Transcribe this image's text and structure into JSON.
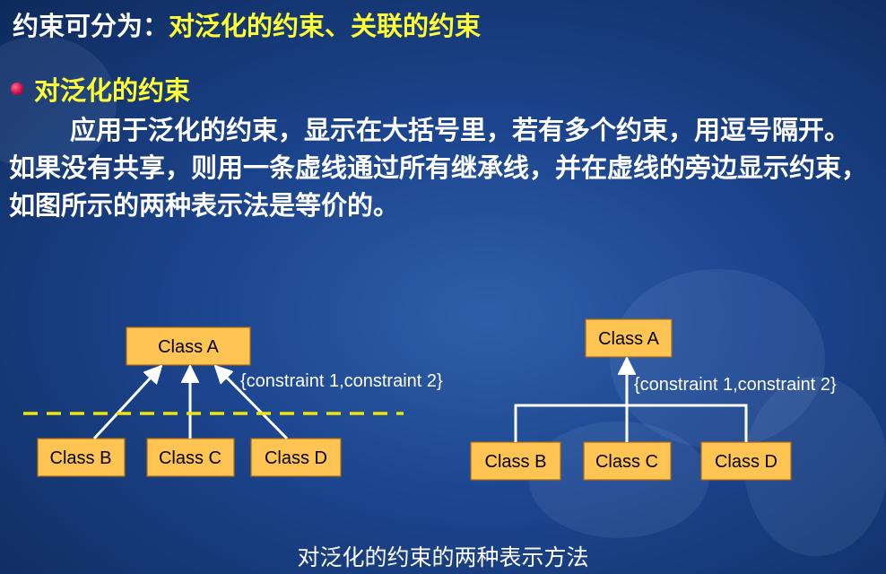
{
  "title": {
    "lead": "约束可分为：",
    "highlight": "对泛化的约束、关联的约束"
  },
  "section": {
    "bullet": "对泛化的约束"
  },
  "paragraph": "应用于泛化的约束，显示在大括号里，若有多个约束，用逗号隔开。如果没有共享，则用一条虚线通过所有继承线，并在虚线的旁边显示约束， 如图所示的两种表示法是等价的。",
  "diagram_left": {
    "parent": "Class A",
    "children": [
      "Class B",
      "Class C",
      "Class D"
    ],
    "constraint": "{constraint 1,constraint 2}"
  },
  "diagram_right": {
    "parent": "Class A",
    "children": [
      "Class B",
      "Class C",
      "Class D"
    ],
    "constraint": "{constraint 1,constraint 2}"
  },
  "caption": "对泛化的约束的两种表示方法",
  "colors": {
    "highlight": "#ffff33",
    "box_fill": "#ffc451",
    "dashed_line": "#f2e600",
    "background": "#1d4690"
  }
}
